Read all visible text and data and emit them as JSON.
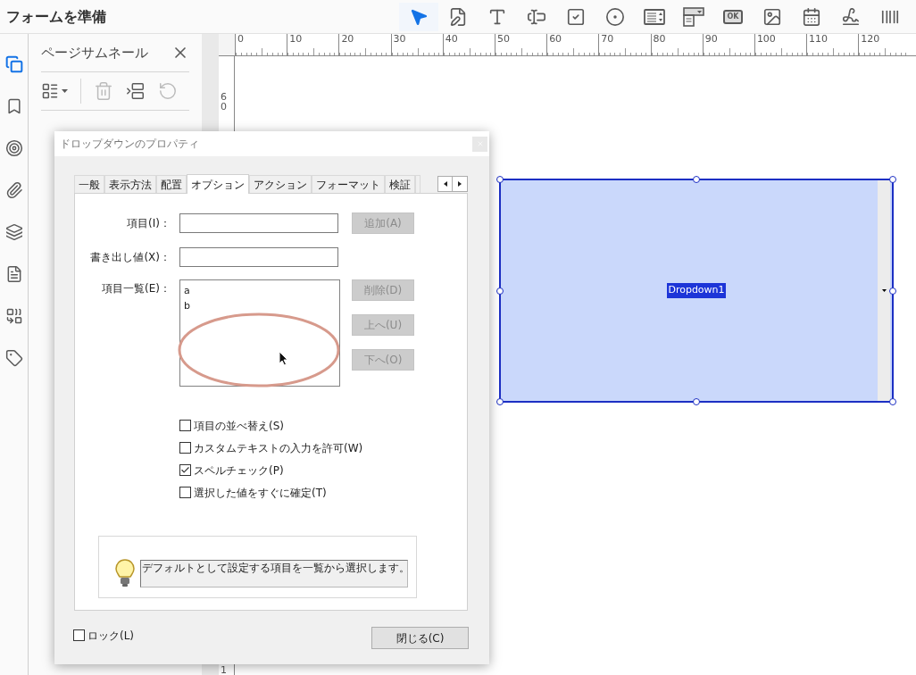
{
  "header": {
    "title": "フォームを準備"
  },
  "tools": [
    {
      "kind": "pointer",
      "selected": true
    },
    {
      "kind": "edit",
      "selected": false
    },
    {
      "kind": "text",
      "selected": false
    },
    {
      "kind": "textfield",
      "selected": false
    },
    {
      "kind": "checkbox",
      "selected": false
    },
    {
      "kind": "radio",
      "selected": false
    },
    {
      "kind": "listbox",
      "selected": false
    },
    {
      "kind": "dropdown",
      "selected": false
    },
    {
      "kind": "button",
      "label": "OK",
      "selected": false
    },
    {
      "kind": "image",
      "selected": false
    },
    {
      "kind": "date",
      "selected": false
    },
    {
      "kind": "signature",
      "selected": false
    },
    {
      "kind": "barcode",
      "selected": false
    }
  ],
  "rail": [
    {
      "kind": "pages",
      "selected": true
    },
    {
      "kind": "bookmark",
      "selected": false
    },
    {
      "kind": "target",
      "selected": false
    },
    {
      "kind": "attachment",
      "selected": false
    },
    {
      "kind": "layers",
      "selected": false
    },
    {
      "kind": "document",
      "selected": false
    },
    {
      "kind": "compare",
      "selected": false
    },
    {
      "kind": "tag",
      "selected": false
    }
  ],
  "thumbnail_panel": {
    "title": "ページサムネール",
    "tools": [
      {
        "kind": "options",
        "disabled": false
      },
      {
        "kind": "trash",
        "disabled": true
      },
      {
        "kind": "insert",
        "disabled": false
      },
      {
        "kind": "rotate",
        "disabled": true
      }
    ]
  },
  "ruler": {
    "horizontal": [
      "0",
      "10",
      "20",
      "30",
      "40",
      "50",
      "60",
      "70",
      "80",
      "90",
      "100",
      "110",
      "120"
    ],
    "vertical": [
      "60",
      "1"
    ]
  },
  "canvas": {
    "field": {
      "name": "Dropdown1",
      "selected": true
    }
  },
  "dialog": {
    "title": "ドロップダウンのプロパティ",
    "tabs": [
      {
        "label": "一般",
        "selected": false
      },
      {
        "label": "表示方法",
        "selected": false
      },
      {
        "label": "配置",
        "selected": false
      },
      {
        "label": "オプション",
        "selected": true
      },
      {
        "label": "アクション",
        "selected": false
      },
      {
        "label": "フォーマット",
        "selected": false
      },
      {
        "label": "検証",
        "selected": false
      }
    ],
    "fields": [
      {
        "label": "項目(I)：",
        "button": {
          "label": "追加(A)",
          "disabled": true
        }
      },
      {
        "label": "書き出し値(X)："
      }
    ],
    "item_list": {
      "label": "項目一覧(E)：",
      "items": [
        "a",
        "b"
      ],
      "buttons": [
        {
          "label": "削除(D)",
          "disabled": true
        },
        {
          "label": "上へ(U)",
          "disabled": true
        },
        {
          "label": "下へ(O)",
          "disabled": true
        }
      ]
    },
    "options": [
      {
        "label": "項目の並べ替え(S)",
        "checked": false
      },
      {
        "label": "カスタムテキストの入力を許可(W)",
        "checked": false
      },
      {
        "label": "スペルチェック(P)",
        "checked": true
      },
      {
        "label": "選択した値をすぐに確定(T)",
        "checked": false
      }
    ],
    "hint": "デフォルトとして設定する項目を一覧から選択します。",
    "lock": {
      "label": "ロック(L)",
      "checked": false
    },
    "close_button": "閉じる(C)"
  }
}
